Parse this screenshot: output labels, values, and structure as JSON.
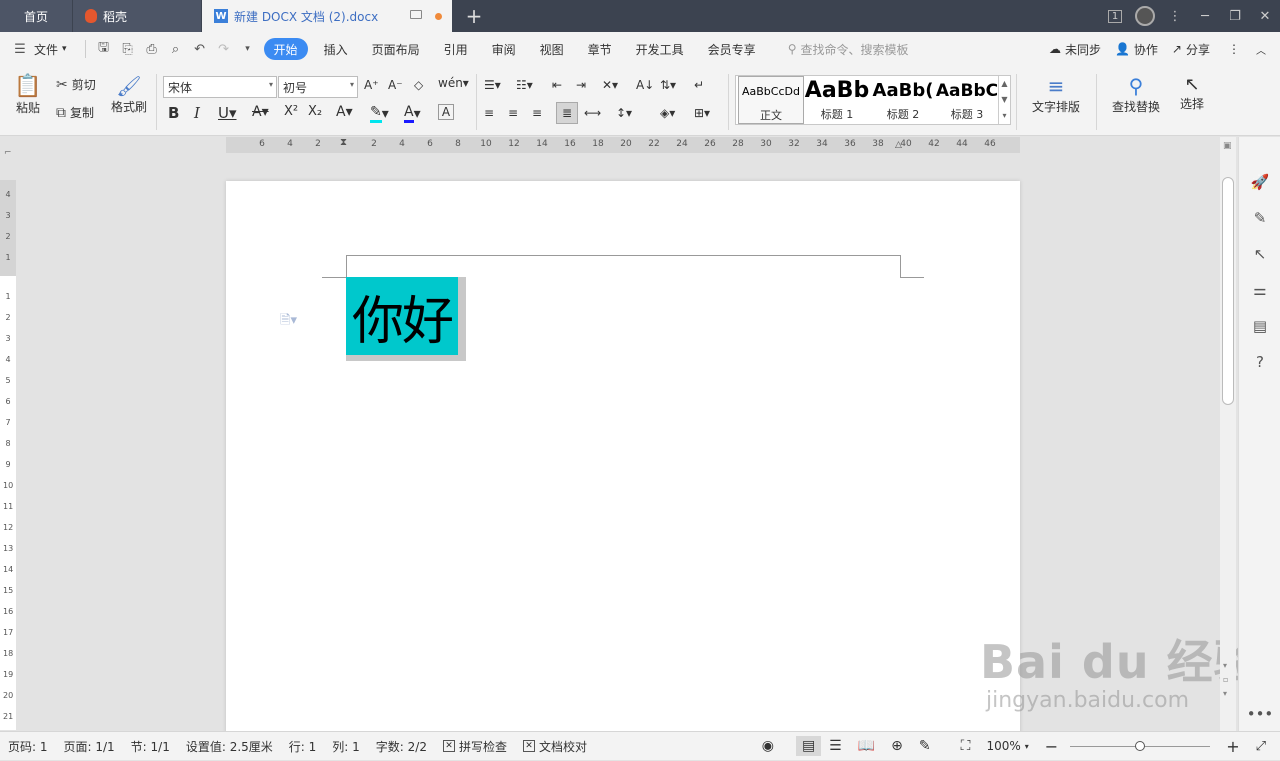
{
  "tabs": {
    "home": "首页",
    "daoke": "稻壳",
    "doc": "新建 DOCX 文档 (2).docx",
    "add": "+"
  },
  "window": {
    "counter": "1",
    "minimize": "─",
    "restore": "❐",
    "close": "✕"
  },
  "menubar": {
    "file": "文件",
    "items": [
      "开始",
      "插入",
      "页面布局",
      "引用",
      "审阅",
      "视图",
      "章节",
      "开发工具",
      "会员专享"
    ],
    "search_placeholder": "查找命令、搜索模板",
    "sync": "未同步",
    "collab": "协作",
    "share": "分享"
  },
  "ribbon": {
    "paste": "粘贴",
    "cut": "剪切",
    "copy": "复制",
    "format_painter": "格式刷",
    "font_name": "宋体",
    "font_size": "初号",
    "styles": [
      {
        "preview": "AaBbCcDd",
        "name": "正文"
      },
      {
        "preview": "AaBb",
        "name": "标题 1"
      },
      {
        "preview": "AaBb(",
        "name": "标题 2"
      },
      {
        "preview": "AaBbC",
        "name": "标题 3"
      }
    ],
    "text_layout": "文字排版",
    "find_replace": "查找替换",
    "select": "选择"
  },
  "ruler_h": {
    "left": [
      "6",
      "4",
      "2"
    ],
    "right": [
      "2",
      "4",
      "6",
      "8",
      "10",
      "12",
      "14",
      "16",
      "18",
      "20",
      "22",
      "24",
      "26",
      "28",
      "30",
      "32",
      "34",
      "36",
      "38",
      "40",
      "42",
      "44",
      "46"
    ]
  },
  "ruler_v": [
    "4",
    "3",
    "2",
    "1",
    "1",
    "2",
    "3",
    "4",
    "5",
    "6",
    "7",
    "8",
    "9",
    "10",
    "11",
    "12",
    "13",
    "14",
    "15",
    "16",
    "17",
    "18",
    "19",
    "20",
    "21"
  ],
  "document": {
    "text": "你好"
  },
  "status": {
    "page_num": "页码: 1",
    "pages": "页面: 1/1",
    "section": "节: 1/1",
    "setting": "设置值: 2.5厘米",
    "row": "行: 1",
    "col": "列: 1",
    "words": "字数: 2/2",
    "spellcheck": "拼写检查",
    "proofread": "文档校对",
    "zoom": "100%",
    "zoom_level": 0.5
  },
  "watermark": {
    "line1": "Bai du 经验",
    "line2": "jingyan.baidu.com"
  },
  "colors": {
    "accent": "#3b8bf2",
    "selection": "#00c8cc",
    "tabbar": "#3c4350"
  }
}
